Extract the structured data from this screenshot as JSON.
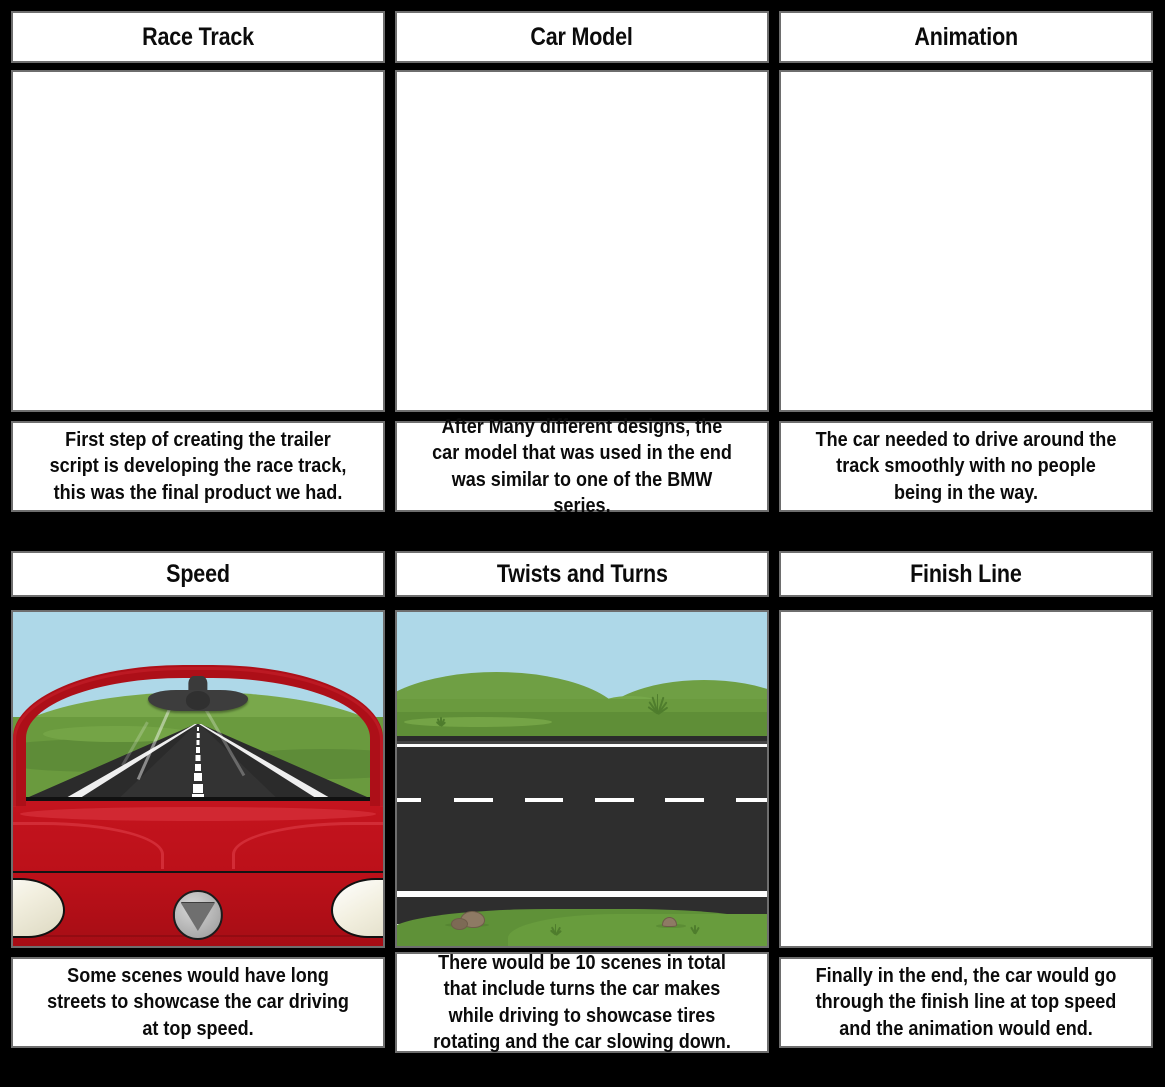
{
  "board": {
    "background_color": "#000000",
    "panel_border_color": "#6e6e6e",
    "panel_fill_color": "#ffffff",
    "rows": 2,
    "columns": 3
  },
  "cells": [
    {
      "id": "race-track",
      "title": "Race Track",
      "caption": "First step of creating the trailer script is developing the race track, this was the final product we had.",
      "art": "blank"
    },
    {
      "id": "car-model",
      "title": "Car Model",
      "caption": "After Many different designs, the car model that was used in the end was similar to one of the BMW series.",
      "art": "blank"
    },
    {
      "id": "animation",
      "title": "Animation",
      "caption": "The car needed to drive around the track smoothly with no people being in the way.",
      "art": "blank"
    },
    {
      "id": "speed",
      "title": "Speed",
      "caption": "Some scenes would have long streets to showcase the car driving at top speed.",
      "art": "car-interior-road-view"
    },
    {
      "id": "twists-and-turns",
      "title": "Twists and Turns",
      "caption": "There would be 10 scenes in total that include turns the car makes while driving to showcase tires rotating and the car slowing down.",
      "art": "side-view-road-scene"
    },
    {
      "id": "finish-line",
      "title": "Finish Line",
      "caption": "Finally in the end, the car would go through the finish line at top speed and the animation would end.",
      "art": "blank"
    }
  ],
  "art_palette": {
    "sky": "#aed8e8",
    "grass_light": "#74a446",
    "grass_mid": "#6a9a3e",
    "grass_dark": "#5e8c38",
    "asphalt": "#2e2e2e",
    "road_line": "#fdfdfd",
    "car_red": "#bb1019",
    "car_red_dark": "#a60d15",
    "car_red_light": "#d6303a",
    "mirror_gray": "#3d3d3d",
    "headlight_cream": "#f2efdf",
    "emblem_silver": "#a9a9a9",
    "rock_brown": "#8e7a64"
  }
}
